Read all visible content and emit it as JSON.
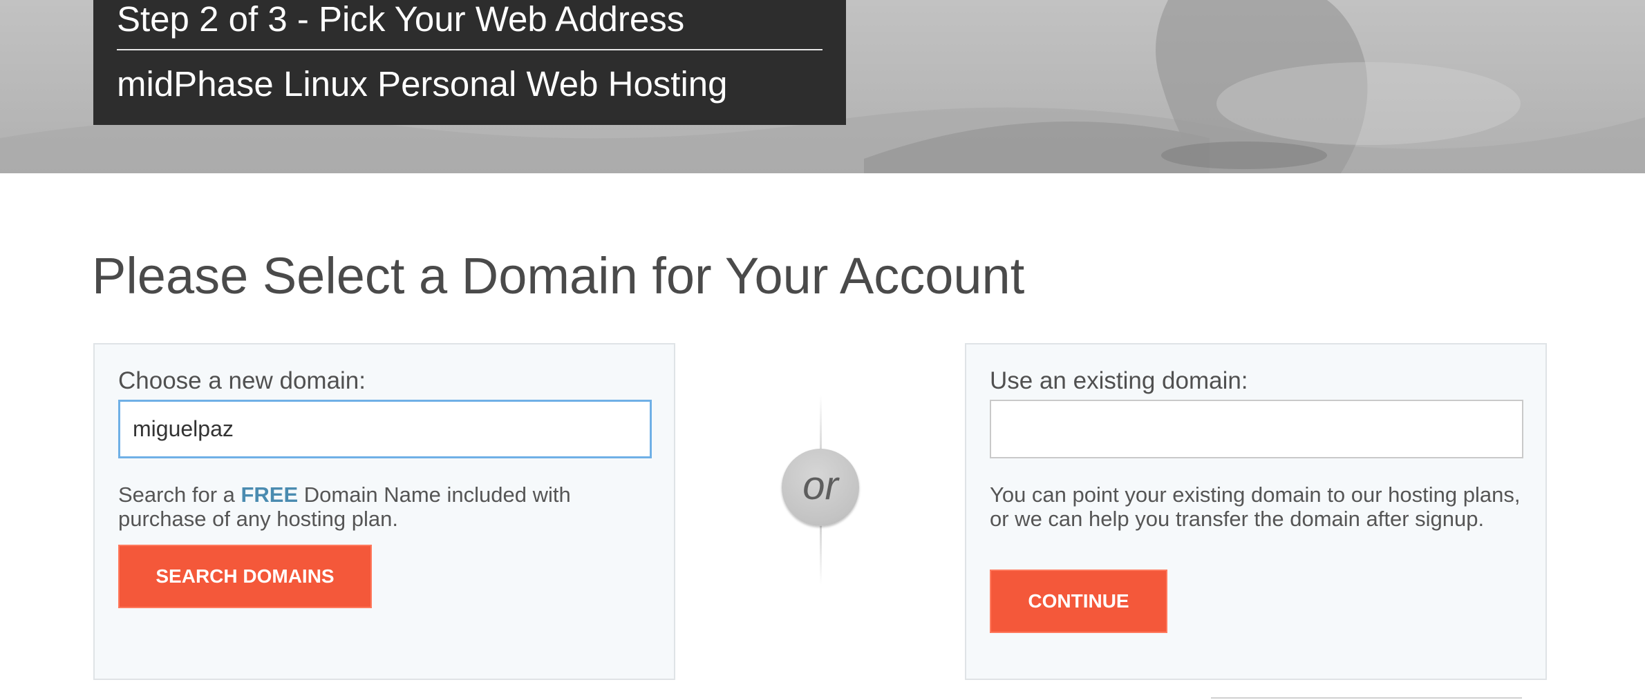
{
  "hero": {
    "step": "Step 2 of 3 - Pick Your Web Address",
    "plan": "midPhase Linux Personal Web Hosting"
  },
  "page_title": "Please Select a Domain for Your Account",
  "new_domain": {
    "heading": "Choose a new domain:",
    "input_value": "miguelpaz",
    "note_prefix": "Search for a ",
    "note_highlight": "FREE",
    "note_suffix": " Domain Name included with purchase of any hosting plan.",
    "button_label": "SEARCH DOMAINS"
  },
  "separator": {
    "label": "or"
  },
  "existing_domain": {
    "heading": "Use an existing domain:",
    "input_value": "",
    "note": "You can point your existing domain to our hosting plans, or we can help you transfer the domain after signup.",
    "button_label": "CONTINUE"
  },
  "colors": {
    "accent": "#f4583a",
    "highlight": "#4a8bb0",
    "banner": "#2d2d2d",
    "focus_ring": "#6fb0e6"
  },
  "icons": [
    "hero-photo-icon"
  ]
}
